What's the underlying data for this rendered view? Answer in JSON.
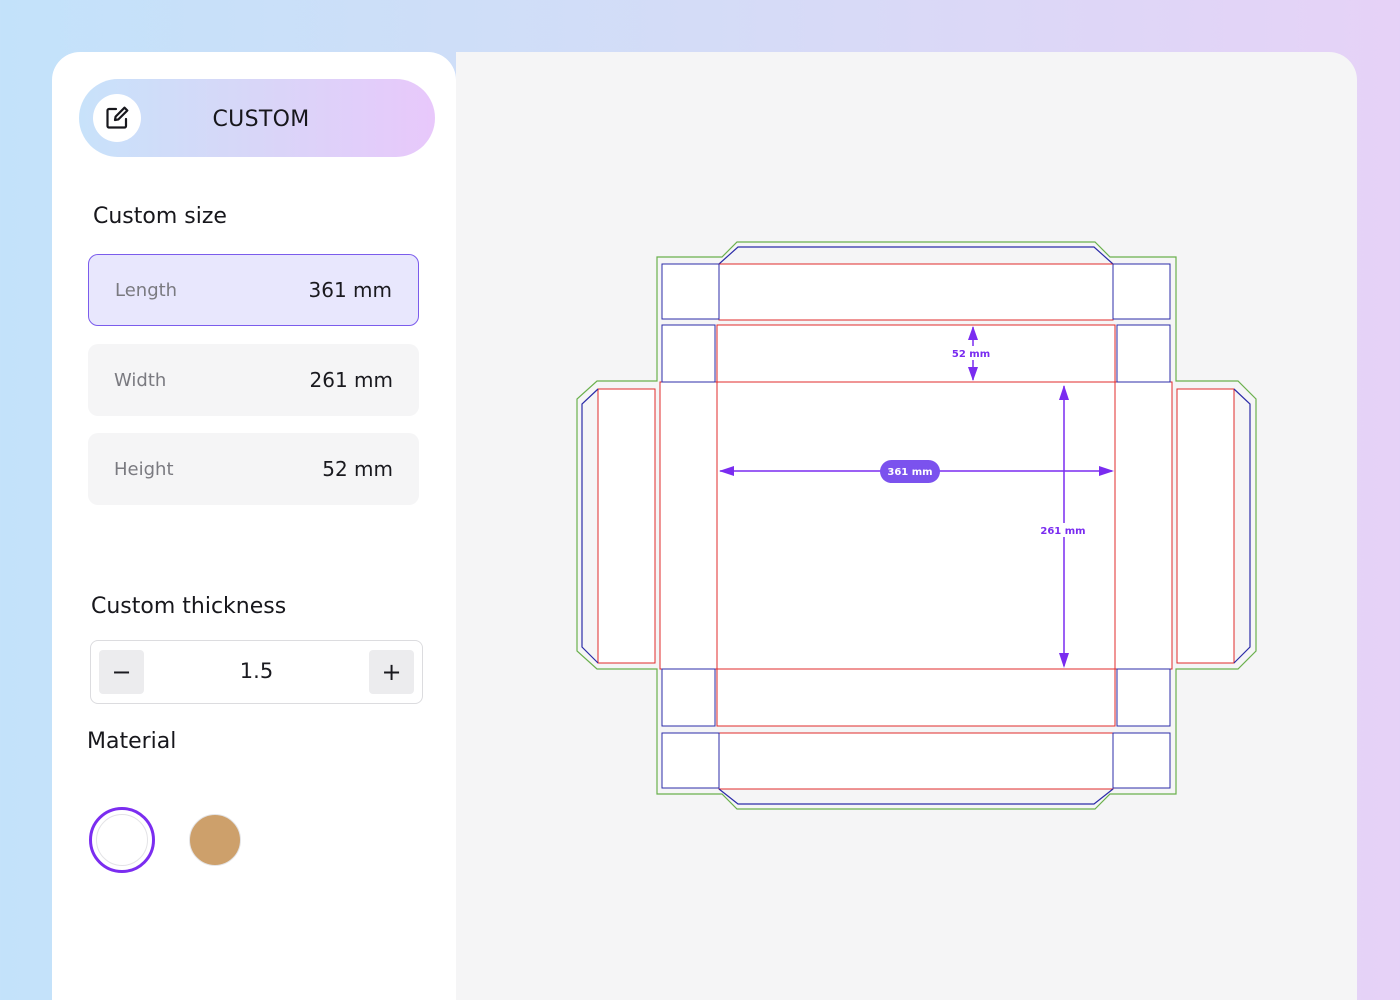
{
  "header": {
    "title": "CUSTOM",
    "edit_icon": "edit-icon"
  },
  "custom_size": {
    "title": "Custom size",
    "fields": [
      {
        "label": "Length",
        "value": "361 mm",
        "active": true
      },
      {
        "label": "Width",
        "value": "261 mm",
        "active": false
      },
      {
        "label": "Height",
        "value": "52 mm",
        "active": false
      }
    ]
  },
  "thickness": {
    "title": "Custom thickness",
    "value": "1.5",
    "decrement_label": "−",
    "increment_label": "+"
  },
  "material": {
    "title": "Material",
    "options": [
      {
        "name": "white",
        "color": "#ffffff",
        "selected": true
      },
      {
        "name": "kraft",
        "color": "#cda06b",
        "selected": false
      }
    ]
  },
  "dieline": {
    "height_label": "52 mm",
    "length_label": "361 mm",
    "width_label": "261 mm",
    "colors": {
      "cut": "#6ab04c",
      "fold": "#e02b2b",
      "panel": "#2c2ca8",
      "measure": "#7a2cf0"
    }
  }
}
